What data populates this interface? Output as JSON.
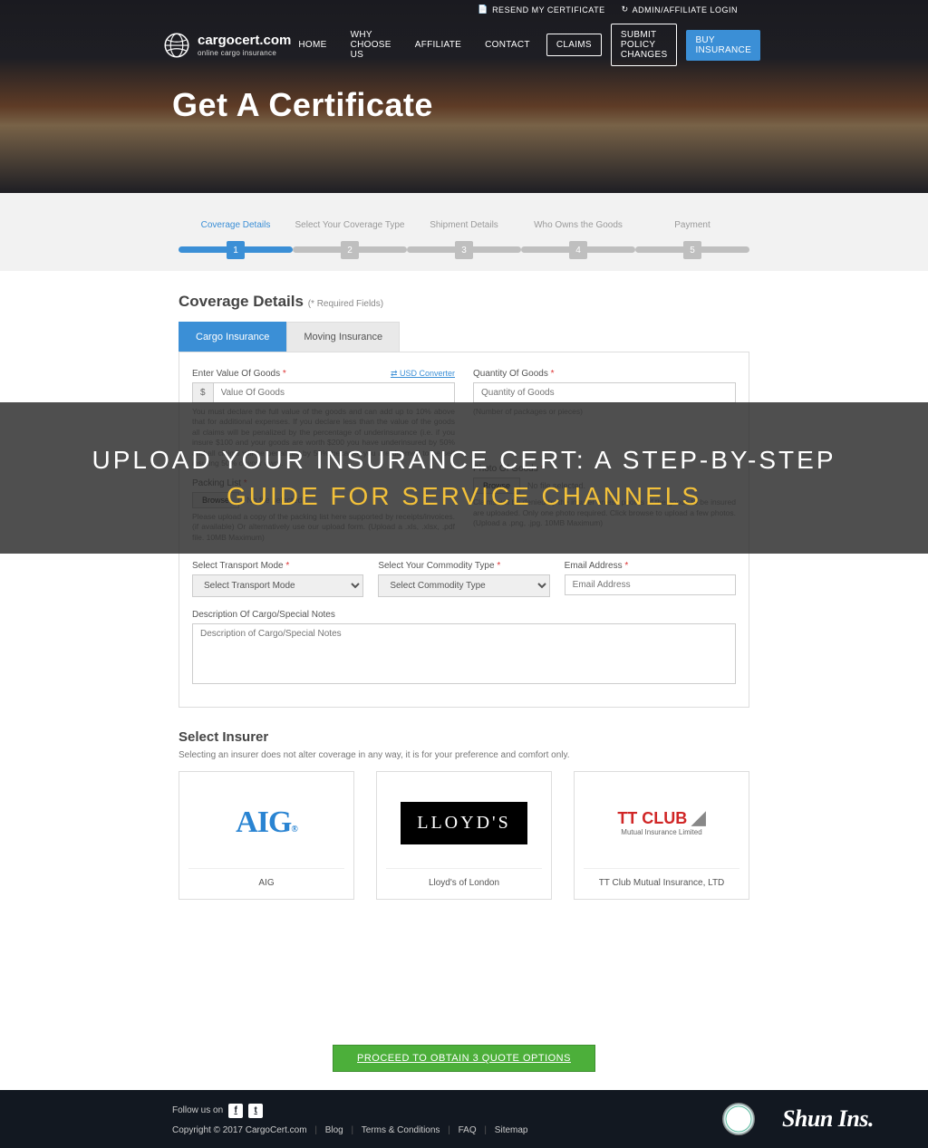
{
  "topbar": {
    "resend": "RESEND MY CERTIFICATE",
    "admin": "ADMIN/AFFILIATE LOGIN"
  },
  "brand": {
    "name": "cargocert.com",
    "tagline": "online cargo insurance"
  },
  "nav": {
    "home": "HOME",
    "why": "WHY CHOOSE US",
    "affiliate": "AFFILIATE",
    "contact": "CONTACT",
    "claims": "CLAIMS",
    "submit": "SUBMIT POLICY CHANGES",
    "buy": "BUY INSURANCE"
  },
  "hero_title": "Get A Certificate",
  "steps": [
    {
      "label": "Coverage Details",
      "num": "1"
    },
    {
      "label": "Select Your Coverage Type",
      "num": "2"
    },
    {
      "label": "Shipment Details",
      "num": "3"
    },
    {
      "label": "Who Owns the Goods",
      "num": "4"
    },
    {
      "label": "Payment",
      "num": "5"
    }
  ],
  "section": {
    "title": "Coverage Details",
    "required_note": "(* Required Fields)"
  },
  "tabs": {
    "cargo": "Cargo Insurance",
    "moving": "Moving Insurance"
  },
  "form": {
    "value_label": "Enter Value Of Goods",
    "usd_converter": "⇄ USD Converter",
    "currency_prefix": "$",
    "value_placeholder": "Value Of Goods",
    "value_hint": "You must declare the full value of the goods and can add up to 10% above that for additional expenses. If you declare less than the value of the goods all claims will be penalized by the percentage of underinsurance (i.e. if you insure $100 and your goods are worth $200 you have underinsured by 50% and all claims will be penalized by 50% because you are deemed to be self insuring 50% of your own).",
    "quantity_label": "Quantity Of Goods",
    "quantity_placeholder": "Quantity of Goods",
    "quantity_hint": "(Number of packages or pieces)",
    "packing_label": "Packing List",
    "packing_hint": "Please upload a copy of the packing list here supported by receipts/invoices. (if available) Or alternatively use our upload form.\n(Upload a .xls, .xlsx, .pdf file. 10MB Maximum)",
    "photo_label": "Photo Of Goods",
    "photo_hint": "Claims will be denied by the insurer unless photos of the goods to be insured are uploaded. Only one photo required. Click browse to upload a few photos.\n(Upload a .png, .jpg. 10MB Maximum)",
    "browse": "Browse",
    "nofile": "No file selected.",
    "transport_label": "Select Transport Mode",
    "transport_placeholder": "Select Transport Mode",
    "commodity_label": "Select Your Commodity Type",
    "commodity_placeholder": "Select Commodity Type",
    "email_label": "Email Address",
    "email_placeholder": "Email Address",
    "desc_label": "Description Of Cargo/Special Notes",
    "desc_placeholder": "Description of Cargo/Special Notes"
  },
  "insurer": {
    "title": "Select Insurer",
    "note": "Selecting an insurer does not alter coverage in any way, it is for your preference and comfort only.",
    "cards": [
      {
        "name": "AIG"
      },
      {
        "name": "Lloyd's of London"
      },
      {
        "name": "TT Club Mutual Insurance, LTD"
      }
    ]
  },
  "overlay": {
    "line1": "UPLOAD YOUR INSURANCE CERT: A STEP-BY-STEP",
    "line2": "GUIDE FOR SERVICE CHANNELS"
  },
  "cta": "PROCEED TO OBTAIN 3 QUOTE OPTIONS",
  "footer": {
    "follow": "Follow us on",
    "copyright": "Copyright © 2017 CargoCert.com",
    "links": {
      "blog": "Blog",
      "terms": "Terms & Conditions",
      "faq": "FAQ",
      "sitemap": "Sitemap"
    },
    "brand_right": "Shun Ins."
  }
}
